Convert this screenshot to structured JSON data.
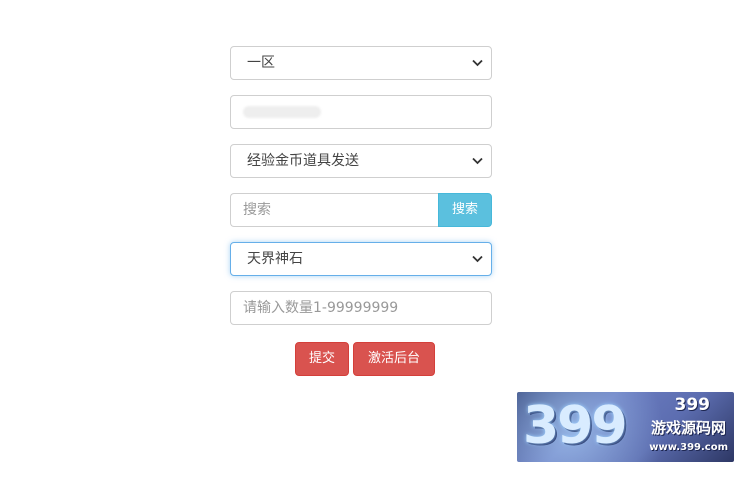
{
  "form": {
    "server_select": {
      "value": "一区",
      "icon": "chevron-down-icon"
    },
    "account_input": {
      "value": ""
    },
    "action_select": {
      "value": "经验金币道具发送",
      "icon": "chevron-down-icon"
    },
    "search": {
      "placeholder": "搜索",
      "button_label": "搜索"
    },
    "item_select": {
      "value": "天界神石",
      "icon": "chevron-down-icon"
    },
    "quantity_input": {
      "placeholder": "请输入数量1-99999999"
    },
    "buttons": {
      "submit_label": "提交",
      "activate_label": "激活后台"
    }
  },
  "watermark": {
    "logo_text": "399",
    "small_text": "399",
    "site_name": "游戏源码网",
    "url": "www.399.com"
  },
  "colors": {
    "info_button": "#5bc0de",
    "danger_button": "#d9534f",
    "focus_border": "#66afe9"
  }
}
